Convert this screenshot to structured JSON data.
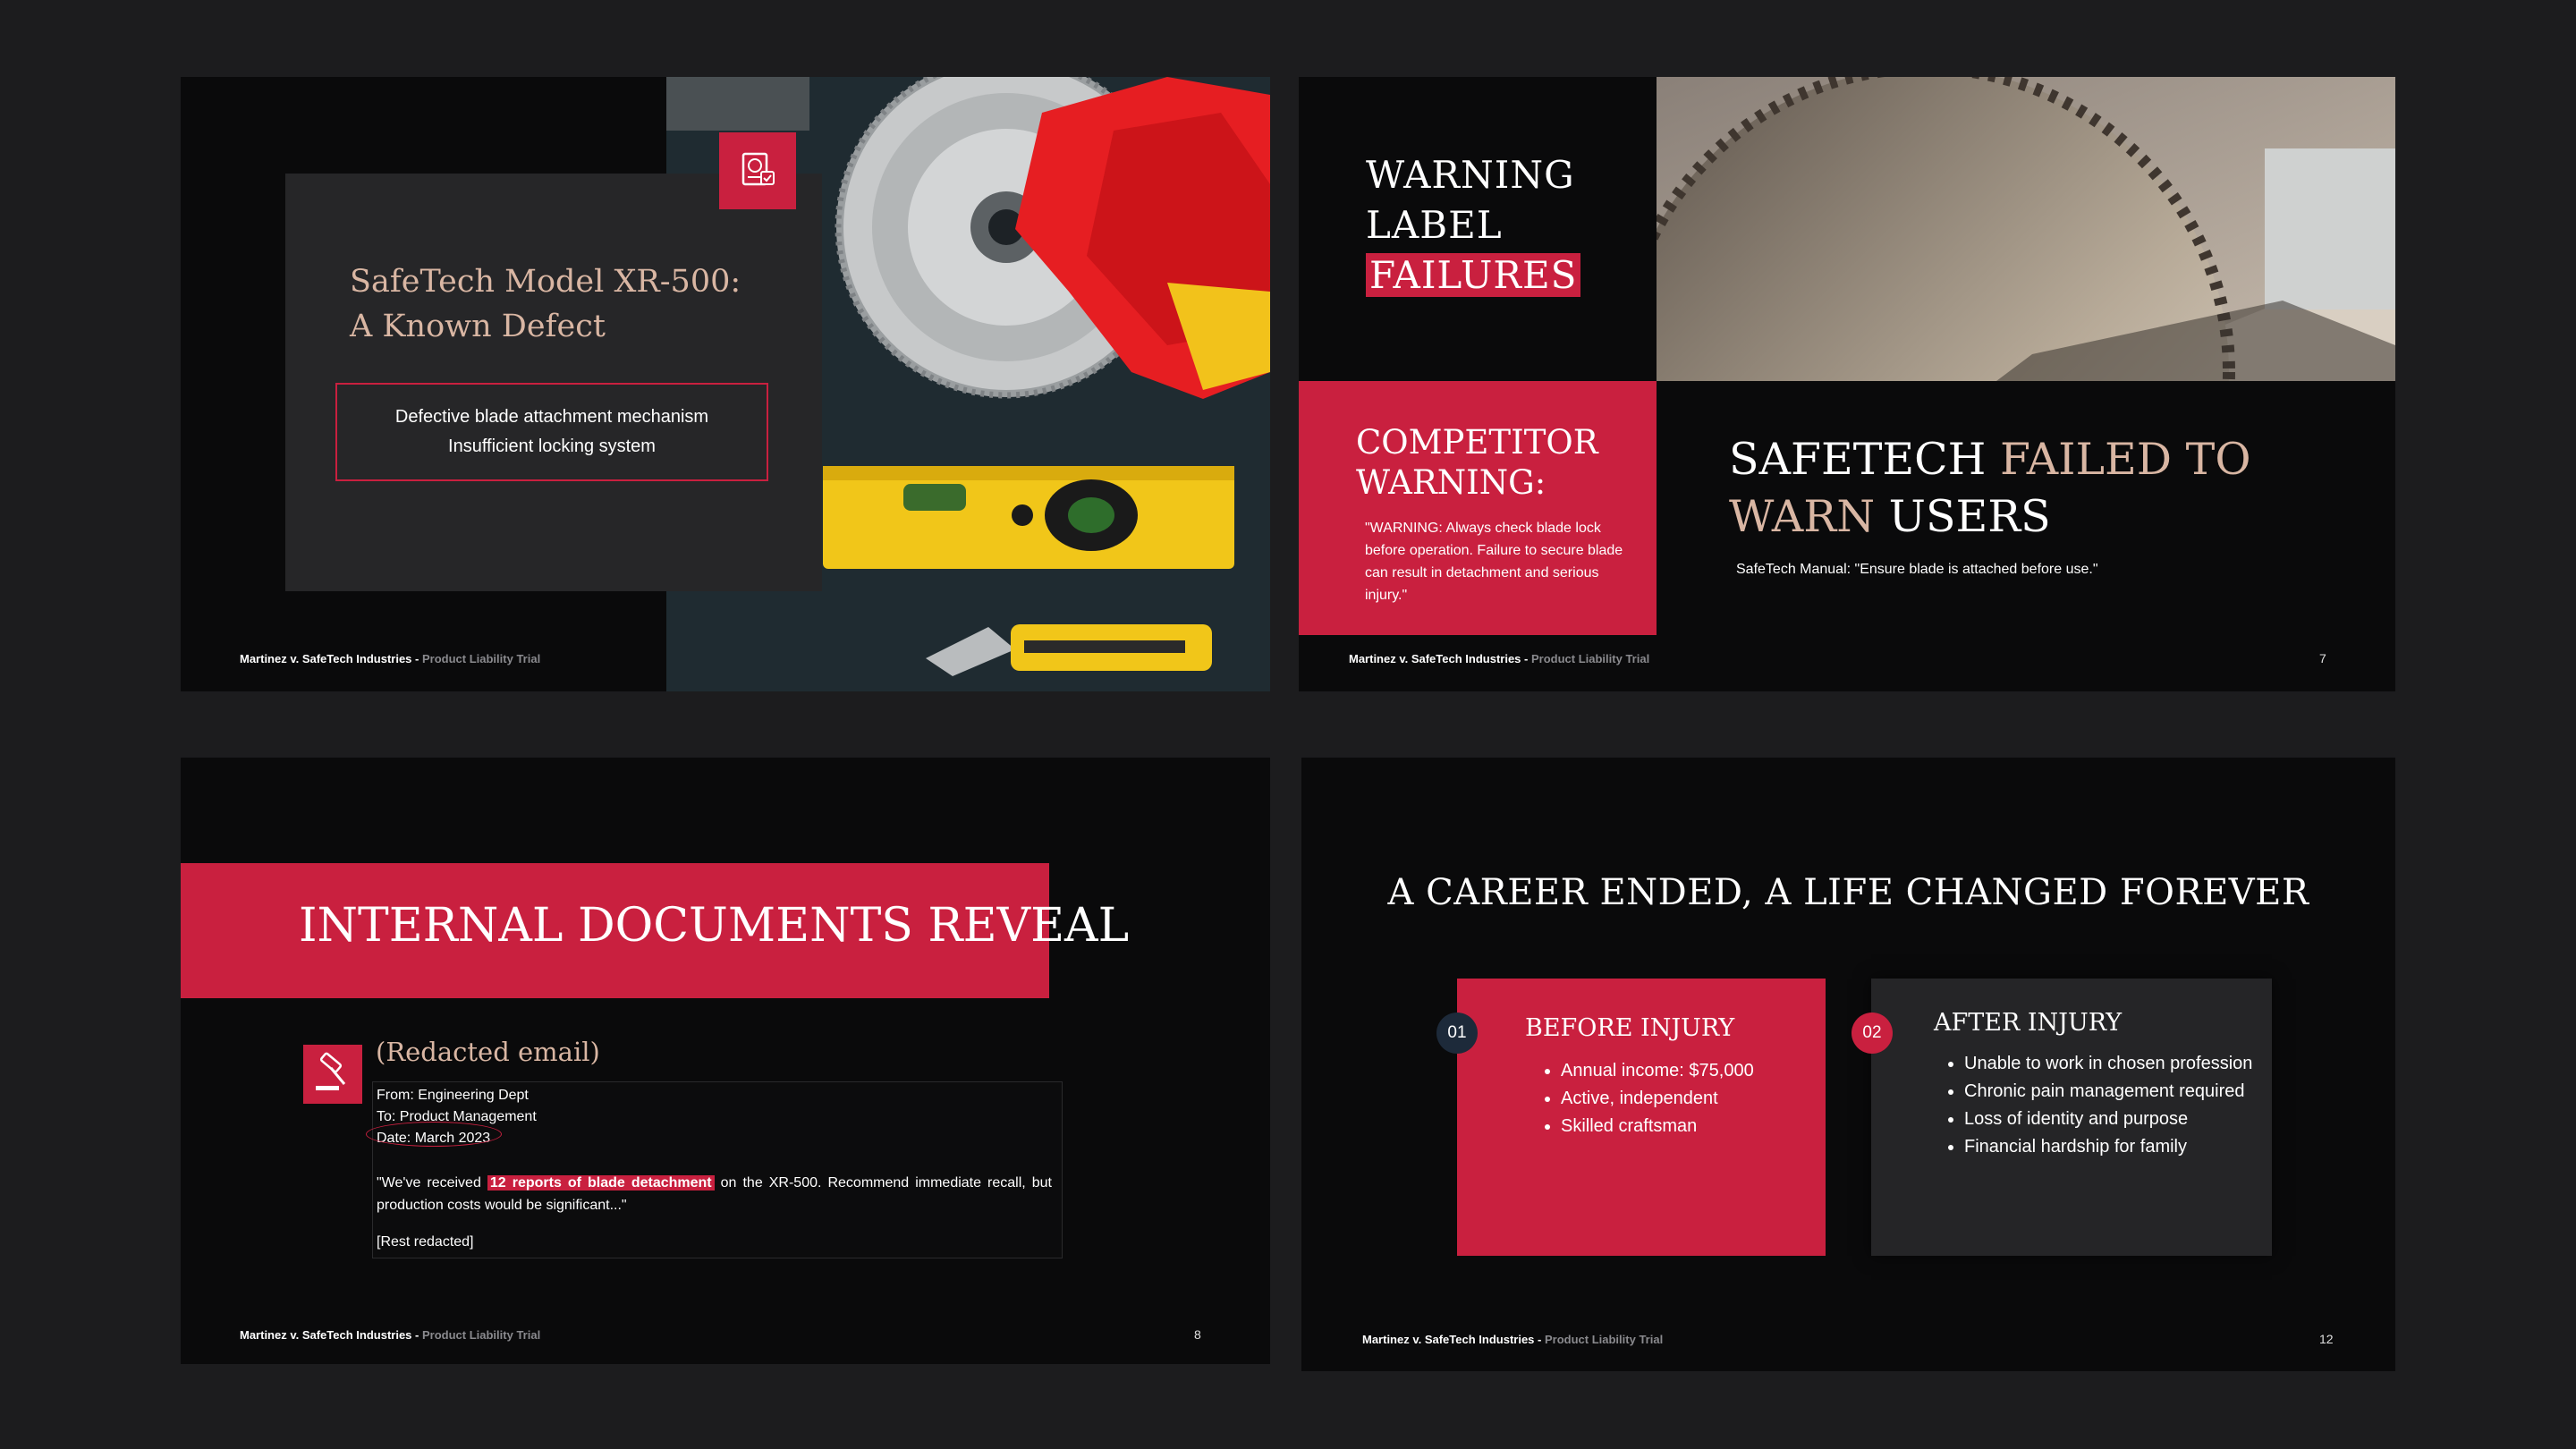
{
  "footer": {
    "case": "Martinez v. SafeTech Industries -",
    "trial": "Product Liability Trial"
  },
  "slide1": {
    "title_line1": "SafeTech Model XR-500:",
    "title_line2": "A Known Defect",
    "bullets": [
      "Defective blade attachment mechanism",
      "Insufficient locking system"
    ],
    "badge_icon": "passport-certificate-icon",
    "photo": "saw-blade-gloves-level-photo"
  },
  "slide2": {
    "heading_line1": "WARNING",
    "heading_line2": "LABEL",
    "heading_highlight": "FAILURES",
    "competitor_title": "COMPETITOR WARNING:",
    "competitor_text": "\"WARNING: Always check blade lock before operation. Failure to secure blade can result in detachment and serious injury.\"",
    "main_plain1": "SAFETECH",
    "main_accent1": "FAILED TO",
    "main_accent2": "WARN",
    "main_plain2": "USERS",
    "manual_quote": "SafeTech Manual: \"Ensure blade is attached before use.\"",
    "page": "7",
    "photo": "table-saw-blade-photo"
  },
  "slide3": {
    "banner": "INTERNAL DOCUMENTS REVEAL",
    "subheading": "(Redacted email)",
    "from": "From: Engineering Dept",
    "to": "To: Product Management",
    "date": "Date: March 2023",
    "quote_pre": "\"We've received",
    "quote_highlight": "12 reports of blade detachment",
    "quote_post": "on the XR-500. Recommend immediate recall, but production costs would be significant...\"",
    "rest": "[Rest redacted]",
    "icon": "gavel-icon",
    "page": "8"
  },
  "slide4": {
    "title": "A CAREER ENDED, A LIFE CHANGED FOREVER",
    "before_num": "01",
    "before_title": "BEFORE INJURY",
    "before_items": [
      "Annual income: $75,000",
      "Active, independent",
      "Skilled craftsman"
    ],
    "after_num": "02",
    "after_title": "AFTER INJURY",
    "after_items": [
      "Unable to work in chosen profession",
      "Chronic pain management required",
      "Loss of identity and purpose",
      "Financial hardship for family"
    ],
    "page": "12"
  },
  "colors": {
    "accent": "#c9203f",
    "gold": "#d9b6a3",
    "background": "#1c1c1e",
    "slide": "#0a0a0b"
  }
}
